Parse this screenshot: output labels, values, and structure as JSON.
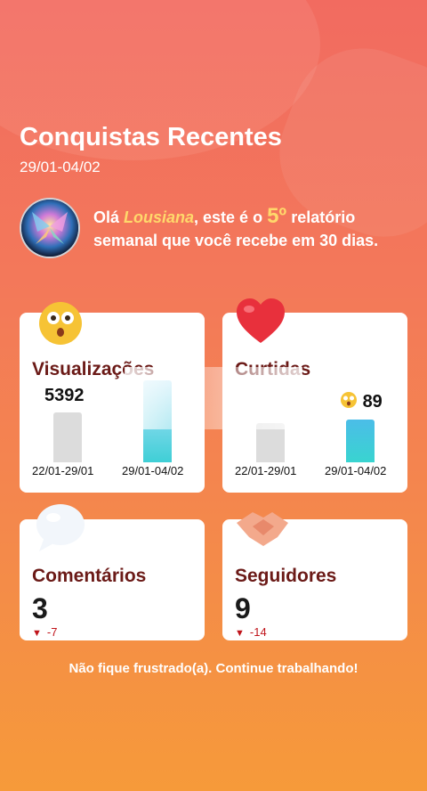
{
  "header": {
    "title": "Conquistas Recentes",
    "date_range": "29/01-04/02"
  },
  "greeting": {
    "prefix": "Olá ",
    "name": "Lousiana",
    "mid": ", este é o ",
    "number": "5º",
    "suffix": " relatório semanal que você recebe em 30 dias."
  },
  "views": {
    "title": "Visualizações",
    "previous_value": "5392",
    "current_value": "",
    "previous_label": "22/01-29/01",
    "current_label": "29/01-04/02",
    "icon": "surprised-face-emoji"
  },
  "likes": {
    "title": "Curtidas",
    "previous_value": "",
    "current_value": "89",
    "previous_label": "22/01-29/01",
    "current_label": "29/01-04/02",
    "icon": "heart-emoji",
    "value_icon": "dizzy-face-emoji"
  },
  "comments": {
    "title": "Comentários",
    "value": "3",
    "delta": "-7",
    "icon": "speech-bubble-emoji"
  },
  "followers": {
    "title": "Seguidores",
    "value": "9",
    "delta": "-14",
    "icon": "handshake-emoji"
  },
  "footer": {
    "message": "Não fique frustrado(a). Continue trabalhando!"
  },
  "colors": {
    "accent": "#ffd86b",
    "title_dark": "#6b1a17",
    "down": "#c0141b"
  }
}
